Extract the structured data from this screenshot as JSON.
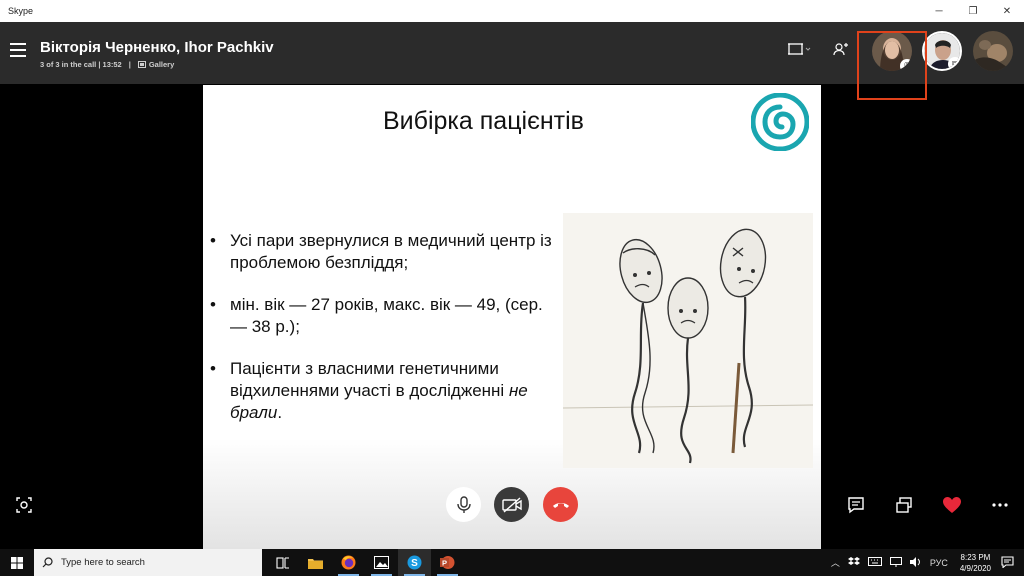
{
  "window": {
    "app_name": "Skype",
    "minimize_icon": "minimize-icon",
    "maximize_icon": "restore-icon",
    "close_icon": "close-icon"
  },
  "call": {
    "title": "Вікторія Черненко, Ihor Pachkiv",
    "status": "3 of 3 in the call | 13:52",
    "separator": "|",
    "view_label": "Gallery"
  },
  "slide": {
    "title": "Вибірка пацієнтів",
    "bullets": [
      {
        "text": "Усі пари звернулися в медичний центр із проблемою безпліддя;"
      },
      {
        "text": "мін. вік — 27 років, макс. вік — 49, (сер. — 38 р.);"
      },
      {
        "text_main": "Пацієнти з власними генетичними відхиленнями участі в дослідженні ",
        "text_italic": "не брали",
        "text_end": "."
      }
    ]
  },
  "controls": {
    "mic": "microphone-icon",
    "video": "video-off-icon",
    "end_call": "end-call-icon",
    "colors": {
      "end_call": "#e8453c",
      "mic_bg": "#ffffff",
      "video_bg": "#3a3a3a",
      "heart": "#e8283a"
    }
  },
  "taskbar": {
    "search_placeholder": "Type here to search",
    "apps": [
      "task-view-icon",
      "file-explorer-icon",
      "firefox-icon",
      "photos-icon",
      "skype-icon",
      "powerpoint-icon"
    ],
    "language": "РУС",
    "time": "8:23 PM",
    "date": "4/9/2020"
  }
}
